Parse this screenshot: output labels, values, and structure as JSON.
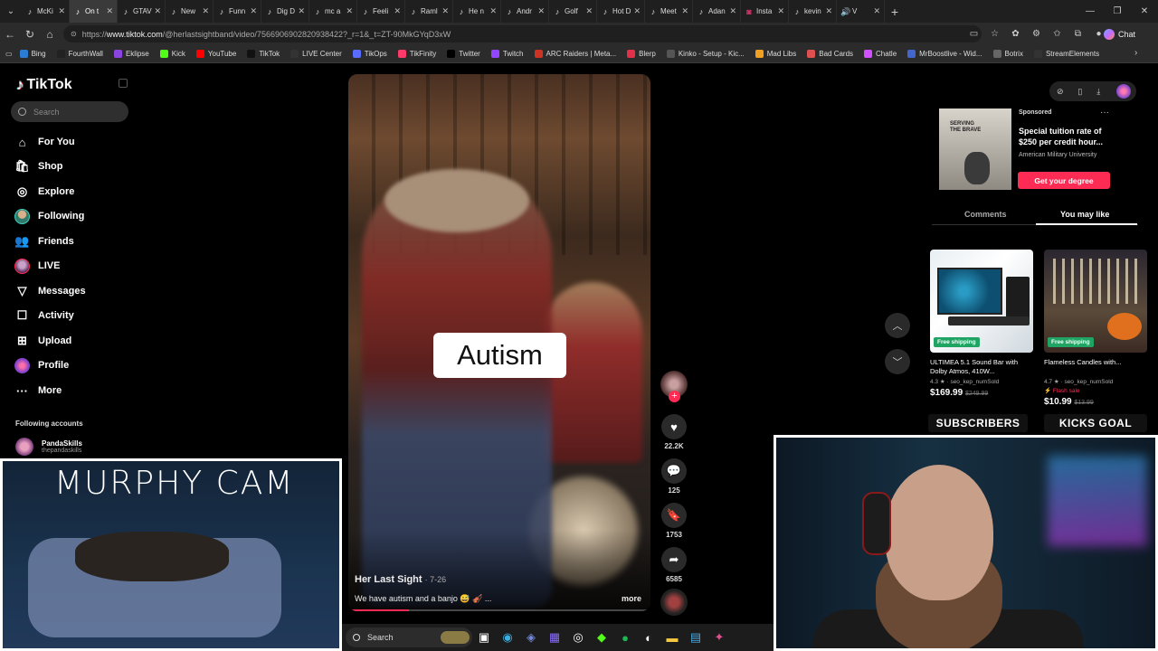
{
  "browser": {
    "tabs": [
      {
        "label": "McKi",
        "fav": "tiktok",
        "active": false
      },
      {
        "label": "On t",
        "fav": "tiktok",
        "active": true
      },
      {
        "label": "GTAV",
        "fav": "tiktok",
        "active": false
      },
      {
        "label": "New",
        "fav": "tiktok",
        "active": false
      },
      {
        "label": "Funn",
        "fav": "tiktok",
        "active": false
      },
      {
        "label": "Dig D",
        "fav": "tiktok",
        "active": false
      },
      {
        "label": "mc a",
        "fav": "tiktok",
        "active": false
      },
      {
        "label": "Feeli",
        "fav": "tiktok",
        "active": false
      },
      {
        "label": "Raml",
        "fav": "tiktok",
        "active": false
      },
      {
        "label": "He n",
        "fav": "tiktok",
        "active": false
      },
      {
        "label": "Andr",
        "fav": "tiktok",
        "active": false
      },
      {
        "label": "Golf",
        "fav": "tiktok",
        "active": false
      },
      {
        "label": "Hot D",
        "fav": "tiktok",
        "active": false
      },
      {
        "label": "Meet",
        "fav": "tiktok",
        "active": false
      },
      {
        "label": "Adan",
        "fav": "tiktok",
        "active": false
      },
      {
        "label": "Insta",
        "fav": "instagram",
        "active": false
      },
      {
        "label": "kevin",
        "fav": "tiktok",
        "active": false
      },
      {
        "label": "V",
        "fav": "tiktok-audio",
        "active": false
      }
    ],
    "url_prefix": "https://",
    "url_domain": "www.tiktok.com",
    "url_path": "/@herlastsightband/video/7566906902820938422?_r=1&_t=ZT-90MkGYqD3xW",
    "chat_label": "Chat",
    "bookmarks": [
      {
        "label": "Bing",
        "color": "#2b7cd3"
      },
      {
        "label": "FourthWall",
        "color": "#222222"
      },
      {
        "label": "Eklipse",
        "color": "#8a44e0"
      },
      {
        "label": "Kick",
        "color": "#53fc18"
      },
      {
        "label": "YouTube",
        "color": "#ff0000"
      },
      {
        "label": "TikTok",
        "color": "#111111"
      },
      {
        "label": "LIVE Center",
        "color": "#333333"
      },
      {
        "label": "TikOps",
        "color": "#5a6bff"
      },
      {
        "label": "TikFinity",
        "color": "#ff3a6a"
      },
      {
        "label": "Twitter",
        "color": "#000000"
      },
      {
        "label": "Twitch",
        "color": "#9146ff"
      },
      {
        "label": "ARC Raiders | Meta...",
        "color": "#cc3322"
      },
      {
        "label": "Blerp",
        "color": "#e0304a"
      },
      {
        "label": "Kinko - Setup - Kic...",
        "color": "#555555"
      },
      {
        "label": "Mad Libs",
        "color": "#f0a020"
      },
      {
        "label": "Bad Cards",
        "color": "#e05050"
      },
      {
        "label": "Chatle",
        "color": "#d050ff"
      },
      {
        "label": "MrBoostlive - Wid...",
        "color": "#4466cc"
      },
      {
        "label": "Botrix",
        "color": "#666666"
      },
      {
        "label": "StreamElements",
        "color": "#333333"
      }
    ]
  },
  "tiktok": {
    "logo": "TikTok",
    "search_placeholder": "Search",
    "nav": [
      {
        "label": "For You",
        "icon": "home-icon",
        "glyph": "⌂"
      },
      {
        "label": "Shop",
        "icon": "shop-bag-icon",
        "glyph": "🛍"
      },
      {
        "label": "Explore",
        "icon": "compass-icon",
        "glyph": "◎"
      },
      {
        "label": "Following",
        "icon": "following-avatar",
        "glyph": ""
      },
      {
        "label": "Friends",
        "icon": "friends-icon",
        "glyph": "👥"
      },
      {
        "label": "LIVE",
        "icon": "live-avatar",
        "glyph": ""
      },
      {
        "label": "Messages",
        "icon": "messages-icon",
        "glyph": "▽"
      },
      {
        "label": "Activity",
        "icon": "activity-icon",
        "glyph": "☐"
      },
      {
        "label": "Upload",
        "icon": "upload-icon",
        "glyph": "⊞"
      },
      {
        "label": "Profile",
        "icon": "profile-avatar",
        "glyph": ""
      },
      {
        "label": "More",
        "icon": "more-icon",
        "glyph": "···"
      }
    ],
    "following_header": "Following accounts",
    "following_accounts": [
      {
        "name": "PandaSkills",
        "handle": "thepandaskills"
      }
    ]
  },
  "video": {
    "caption_overlay": "Autism",
    "author": "Her Last Sight",
    "date": "7-26",
    "description": "We have autism and a banjo 😅 🎻 ...",
    "more_label": "more",
    "progress": 0.2,
    "likes": "22.2K",
    "comments": "125",
    "saves": "1753",
    "shares": "6585"
  },
  "right_panel": {
    "ad": {
      "image_text": "SERVING THE BRAVE",
      "sponsored_label": "Sponsored",
      "title": "Special tuition rate of $250 per credit hour...",
      "advertiser": "American Military University",
      "cta": "Get your degree"
    },
    "tabs": [
      "Comments",
      "You may like"
    ],
    "products": [
      {
        "badge": "Free shipping",
        "name": "ULTIMEA 5.1 Sound Bar with Dolby Atmos, 410W...",
        "rating": "4.3 ★ · seo_kep_numSold",
        "sale": "",
        "price": "$169.99",
        "old_price": "$249.99"
      },
      {
        "badge": "Free shipping",
        "name": "Flameless Candles with...",
        "rating": "4.7 ★ · seo_kep_numSold",
        "sale": "Flash sale",
        "price": "$10.99",
        "old_price": "$13.99"
      }
    ],
    "goals": [
      "SUBSCRIBERS",
      "KICKS GOAL"
    ]
  },
  "stream": {
    "murphy_title": "MURPHY CAM"
  },
  "taskbar": {
    "search_label": "Search"
  }
}
